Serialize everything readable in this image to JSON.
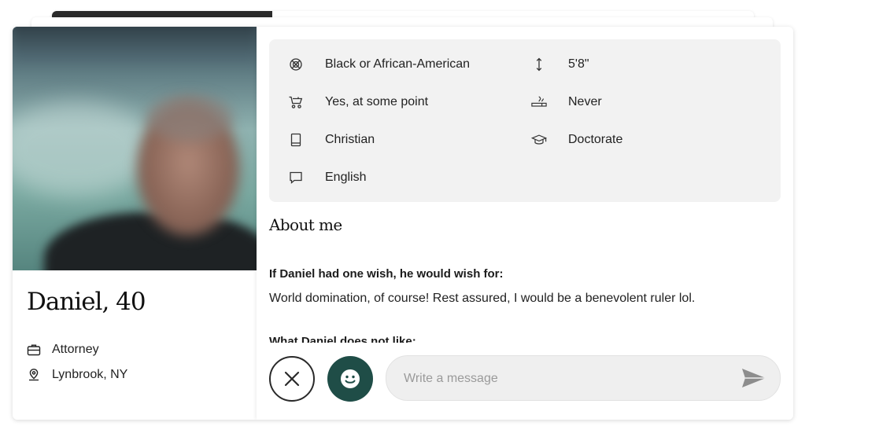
{
  "profile": {
    "name": "Daniel, 40",
    "job": "Attorney",
    "location": "Lynbrook, NY"
  },
  "attributes": [
    {
      "icon": "ethnicity-icon",
      "label": "Black or African-American"
    },
    {
      "icon": "height-icon",
      "label": "5'8\""
    },
    {
      "icon": "stroller-icon",
      "label": "Yes, at some point"
    },
    {
      "icon": "smoking-icon",
      "label": "Never"
    },
    {
      "icon": "book-icon",
      "label": "Christian"
    },
    {
      "icon": "graduation-cap-icon",
      "label": "Doctorate"
    },
    {
      "icon": "speech-bubble-icon",
      "label": "English"
    }
  ],
  "about": {
    "title": "About me",
    "prompts": [
      {
        "question": "If Daniel had one wish, he would wish for:",
        "answer": "World domination, of course! Rest assured, I would be a benevolent ruler lol."
      },
      {
        "question": "What Daniel does not like:"
      }
    ]
  },
  "actions": {
    "message_placeholder": "Write a message"
  },
  "colors": {
    "accent": "#1f4d47",
    "attr_bg": "#f2f2f2"
  }
}
